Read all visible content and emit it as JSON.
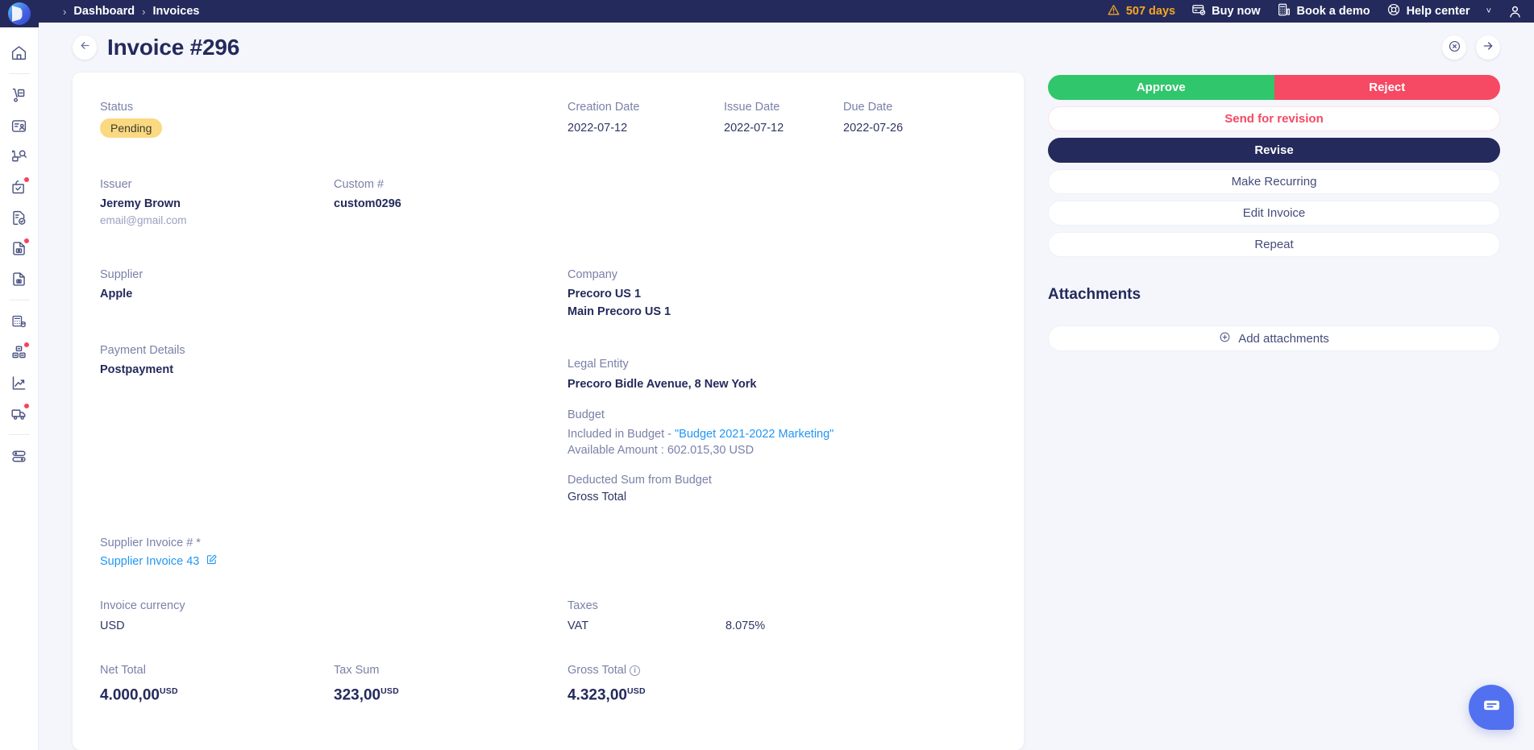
{
  "topbar": {
    "breadcrumb": {
      "chevron": "›",
      "items": [
        "Dashboard",
        "Invoices"
      ]
    },
    "trial": {
      "label": "507 days",
      "icon": "warning-triangle-icon",
      "color": "#f6a623"
    },
    "links": [
      {
        "label": "Buy now",
        "icon": "card-check-icon"
      },
      {
        "label": "Book a demo",
        "icon": "calculator-icon"
      },
      {
        "label": "Help center",
        "icon": "lifebuoy-icon"
      }
    ],
    "caret": "˅",
    "avatar_icon": "user-icon"
  },
  "header": {
    "back_icon": "arrow-left-icon",
    "title": "Invoice #296",
    "close_icon": "close-circle-icon",
    "next_icon": "arrow-right-icon"
  },
  "sidebar": {
    "logo": "precoro-logo",
    "items": [
      {
        "name": "home",
        "icon": "home-icon",
        "badge": false
      },
      {
        "name": "purchase-requisitions",
        "icon": "hand-truck-icon",
        "badge": false
      },
      {
        "name": "requests",
        "icon": "request-card-icon",
        "badge": false
      },
      {
        "name": "rfq",
        "icon": "cart-search-icon",
        "badge": false
      },
      {
        "name": "orders-approval",
        "icon": "bag-check-icon",
        "badge": true
      },
      {
        "name": "receipts",
        "icon": "document-check-icon",
        "badge": false
      },
      {
        "name": "invoices",
        "icon": "document-photo-icon",
        "badge": true
      },
      {
        "name": "documents",
        "icon": "document-icon",
        "badge": false
      },
      {
        "name": "budgets",
        "icon": "calculator-coins-icon",
        "badge": false
      },
      {
        "name": "inventory",
        "icon": "boxes-icon",
        "badge": true
      },
      {
        "name": "reports",
        "icon": "chart-up-icon",
        "badge": false
      },
      {
        "name": "suppliers-delivery",
        "icon": "truck-icon",
        "badge": true
      },
      {
        "name": "settings-toggles",
        "icon": "toggles-icon",
        "badge": false
      }
    ]
  },
  "invoice": {
    "status": {
      "label": "Status",
      "value": "Pending",
      "color": "#fbd981"
    },
    "creation_date": {
      "label": "Creation Date",
      "value": "2022-07-12"
    },
    "issue_date": {
      "label": "Issue Date",
      "value": "2022-07-12"
    },
    "due_date": {
      "label": "Due Date",
      "value": "2022-07-26"
    },
    "issuer": {
      "label": "Issuer",
      "value": "Jeremy Brown",
      "email": "email@gmail.com"
    },
    "custom_number": {
      "label": "Custom #",
      "value": "custom0296"
    },
    "supplier": {
      "label": "Supplier",
      "value": "Apple"
    },
    "company": {
      "label": "Company",
      "value": "Precoro US 1",
      "value2": "Main Precoro US 1"
    },
    "payment_details": {
      "label": "Payment Details",
      "value": "Postpayment"
    },
    "legal_entity": {
      "label": "Legal Entity",
      "value": "Precoro Bidle Avenue, 8 New York"
    },
    "budget": {
      "label": "Budget",
      "included_prefix": "Included in Budget - ",
      "included_name": "\"Budget 2021-2022 Marketing\"",
      "available": "Available Amount : 602.015,30 USD",
      "deducted_label": "Deducted Sum from Budget",
      "deducted_value": "Gross Total"
    },
    "supplier_invoice": {
      "label": "Supplier Invoice # *",
      "value": "Supplier Invoice 43",
      "edit_icon": "edit-square-icon"
    },
    "currency": {
      "label": "Invoice currency",
      "value": "USD"
    },
    "taxes": {
      "label": "Taxes",
      "name": "VAT",
      "rate": "8.075%"
    },
    "totals": [
      {
        "label": "Net Total",
        "amount": "4.000,00",
        "currency": "USD",
        "info": false
      },
      {
        "label": "Tax Sum",
        "amount": "323,00",
        "currency": "USD",
        "info": false
      },
      {
        "label": "Gross Total",
        "amount": "4.323,00",
        "currency": "USD",
        "info": true
      }
    ]
  },
  "actions": {
    "approve": "Approve",
    "reject": "Reject",
    "send_for_revision": "Send for revision",
    "revise": "Revise",
    "make_recurring": "Make Recurring",
    "edit_invoice": "Edit Invoice",
    "repeat": "Repeat",
    "colors": {
      "approve": "#30c66c",
      "reject": "#f54964",
      "revise": "#242a5c"
    }
  },
  "attachments": {
    "title": "Attachments",
    "add_label": "Add attachments",
    "add_icon": "plus-circle-icon"
  },
  "chat": {
    "icon": "chat-bubble-icon",
    "color": "#5271f0"
  }
}
